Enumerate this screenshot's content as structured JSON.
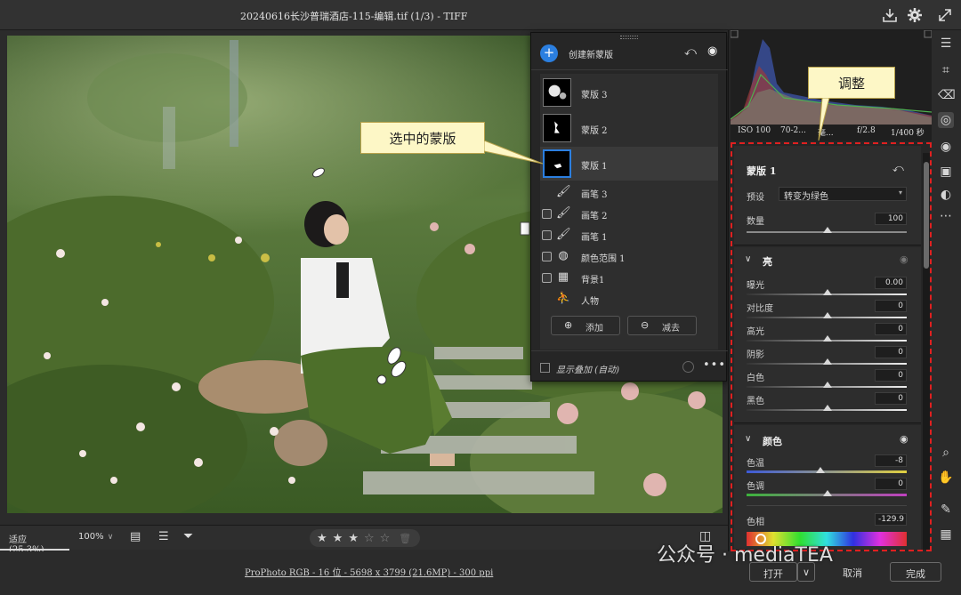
{
  "window": {
    "title": "20240616长沙普瑞酒店-115-编辑.tif (1/3) -  TIFF",
    "icons": [
      "download-icon",
      "gear-icon",
      "collapse-icon"
    ]
  },
  "mask_panel": {
    "create_label": "创建新蒙版",
    "masks": [
      {
        "label": "蒙版 3",
        "selected": false
      },
      {
        "label": "蒙版 2",
        "selected": false
      },
      {
        "label": "蒙版 1",
        "selected": true
      }
    ],
    "components": [
      {
        "label": "画笔 3",
        "icon": "brush-icon"
      },
      {
        "label": "画笔 2",
        "icon": "brush-icon"
      },
      {
        "label": "画笔 1",
        "icon": "brush-icon"
      },
      {
        "label": "颜色范围 1",
        "icon": "color-range-icon"
      },
      {
        "label": "背景1",
        "icon": "background-icon"
      },
      {
        "label": "人物",
        "icon": "people-icon"
      }
    ],
    "add_label": "添加",
    "subtract_label": "减去",
    "overlay_label": "显示叠加 (自动)"
  },
  "callouts": {
    "selected_mask": "选中的蒙版",
    "adjust": "调整"
  },
  "histogram": {
    "iso": "ISO 100",
    "lens": "70-2...",
    "lens_unit": "毫...",
    "aperture": "f/2.8",
    "shutter": "1/400 秒"
  },
  "adjust": {
    "mask_title": "蒙版 1",
    "preset_label": "预设",
    "preset_value": "转变为绿色",
    "amount_label": "数量",
    "amount_value": "100",
    "light_title": "亮",
    "light_rows": [
      {
        "label": "曝光",
        "value": "0.00"
      },
      {
        "label": "对比度",
        "value": "0"
      },
      {
        "label": "高光",
        "value": "0"
      },
      {
        "label": "阴影",
        "value": "0"
      },
      {
        "label": "白色",
        "value": "0"
      },
      {
        "label": "黑色",
        "value": "0"
      }
    ],
    "color_title": "颜色",
    "color_rows": [
      {
        "label": "色温",
        "value": "-8"
      },
      {
        "label": "色调",
        "value": "0"
      }
    ],
    "hue_label": "色相",
    "hue_value": "-129.9"
  },
  "bottom": {
    "zoom_fit": "适应 (25.3%)",
    "zoom_100": "100%",
    "rating": 3,
    "rating_max": 5
  },
  "status": {
    "info": "ProPhoto RGB - 16 位 - 5698 x 3799 (21.6MP) - 300 ppi",
    "open": "打开",
    "cancel": "取消",
    "done": "完成"
  },
  "watermark": "公众号 · mediaTEA",
  "colors": {
    "accent": "#2b7fe0",
    "callout_bg": "#fdf7c6",
    "highlight_border": "#e02020"
  }
}
